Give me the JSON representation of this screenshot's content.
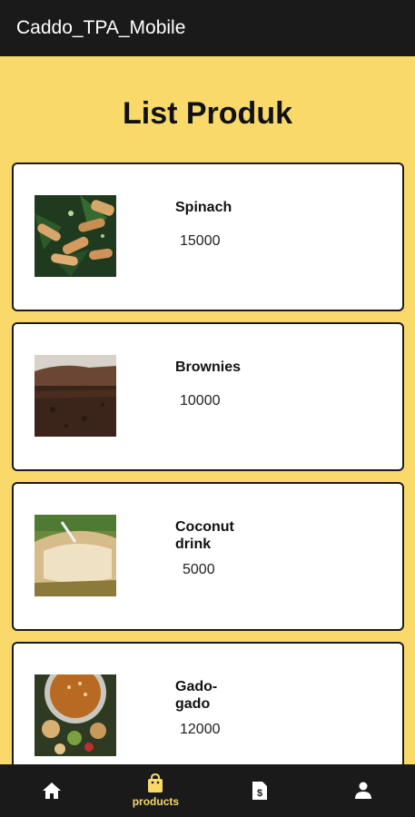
{
  "appbar": {
    "title": "Caddo_TPA_Mobile"
  },
  "page": {
    "title": "List Produk"
  },
  "products": [
    {
      "name": "Spinach",
      "price": "15000"
    },
    {
      "name": "Brownies",
      "price": "10000"
    },
    {
      "name": "Coconut drink",
      "price": "5000"
    },
    {
      "name": "Gado-gado",
      "price": "12000"
    }
  ],
  "nav": {
    "items": [
      {
        "icon": "home-icon",
        "label": ""
      },
      {
        "icon": "shopping-bag-icon",
        "label": "products"
      },
      {
        "icon": "invoice-icon",
        "label": ""
      },
      {
        "icon": "person-icon",
        "label": ""
      }
    ],
    "active": "products"
  },
  "colors": {
    "background": "#f8d96a",
    "bar": "#1a1a1a",
    "accent": "#f8d96a"
  }
}
